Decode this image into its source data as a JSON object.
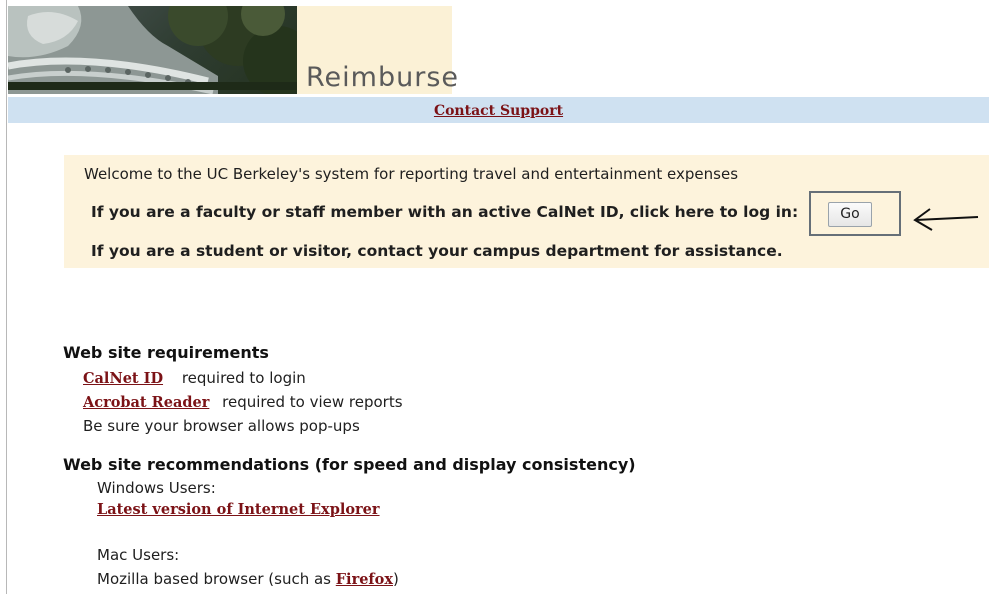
{
  "header": {
    "app_title": "Reimburse",
    "support_link": "Contact Support"
  },
  "welcome": {
    "intro": "Welcome to the UC Berkeley's system for reporting travel and entertainment expenses",
    "login_prompt": "If you are a faculty or staff member with an active CalNet ID, click here to log in:",
    "go_label": "Go",
    "student_notice": "If you are a student or visitor, contact your campus department for assistance."
  },
  "requirements": {
    "heading": "Web site requirements",
    "calnet_link": "CalNet ID",
    "calnet_note": "required to login",
    "acrobat_link": "Acrobat Reader",
    "acrobat_note": "required to view reports",
    "popups_note": "Be sure your browser allows pop-ups"
  },
  "recommendations": {
    "heading": "Web site recommendations (for speed and display consistency)",
    "windows_label": "Windows Users:",
    "ie_link": "Latest version of Internet Explorer",
    "mac_label": "Mac Users:",
    "mozilla_prefix": "Mozilla based browser (such as ",
    "firefox_link": "Firefox",
    "mozilla_suffix": ")"
  },
  "colors": {
    "link": "#7b1216",
    "support_bar": "#cfe1f1",
    "welcome_panel": "#fdf3dc"
  },
  "icons": [
    "sather-gate-banner-image",
    "arrow-left-icon"
  ]
}
